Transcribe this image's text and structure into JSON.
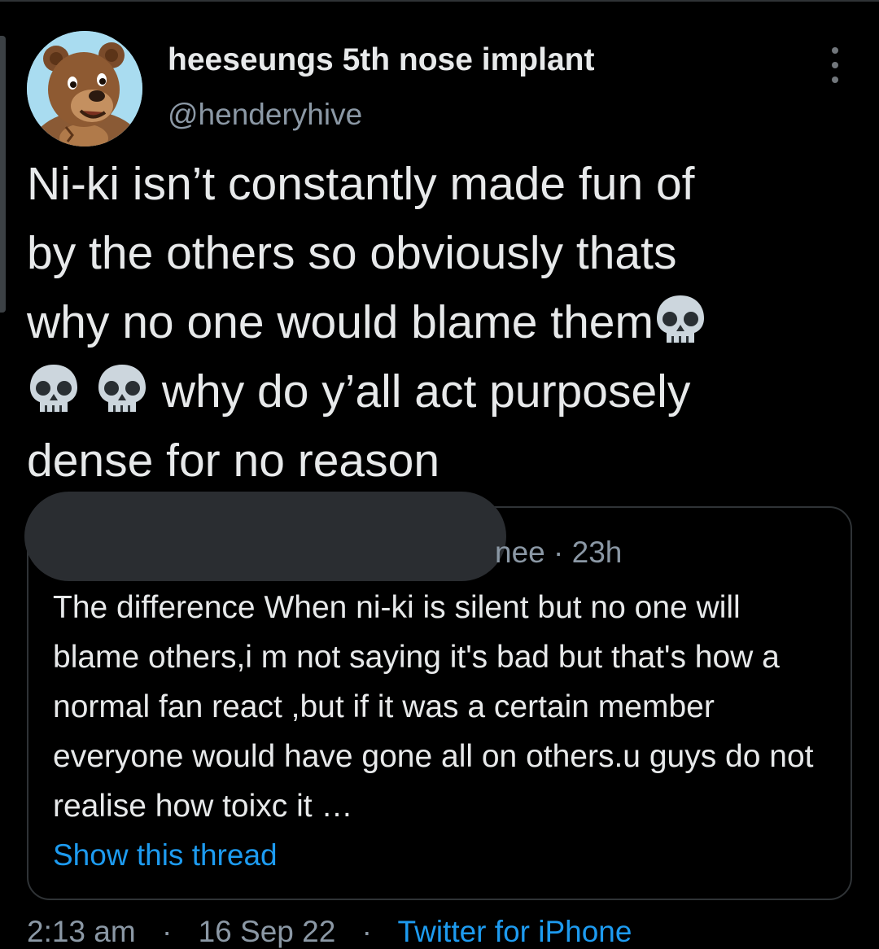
{
  "author": {
    "display_name": "heeseungs 5th nose implant",
    "handle": "@henderyhive",
    "avatar_icon": "cartoon-bear-avatar"
  },
  "menu": {
    "more_icon": "more-vertical-icon"
  },
  "tweet": {
    "line1": "Ni-ki isn’t constantly made fun of",
    "line2": "by the others so obviously thats",
    "line3": "why no one would blame them",
    "line4": " why do y’all act purposely",
    "line5": "dense for no reason",
    "emoji_icon": "skull-emoji-icon"
  },
  "quoted_tweet": {
    "author_partial": "nee",
    "time_separator": "·",
    "timestamp": "23h",
    "text": "The difference When ni-ki is silent but no one will blame others,i m not saying it's bad but that's how a normal fan react ,but if it was a certain member everyone would have gone all on others.u guys do not realise how toixc it …",
    "show_thread_label": "Show this thread"
  },
  "footer": {
    "time": "2:13 am",
    "date": "16 Sep 22",
    "separator": "·",
    "source": "Twitter for iPhone"
  },
  "colors": {
    "background": "#000000",
    "text_primary": "#e7e9ea",
    "text_secondary": "#8b98a5",
    "link": "#1d9bf0",
    "border": "#2f3336",
    "redaction": "#2a2d31"
  }
}
